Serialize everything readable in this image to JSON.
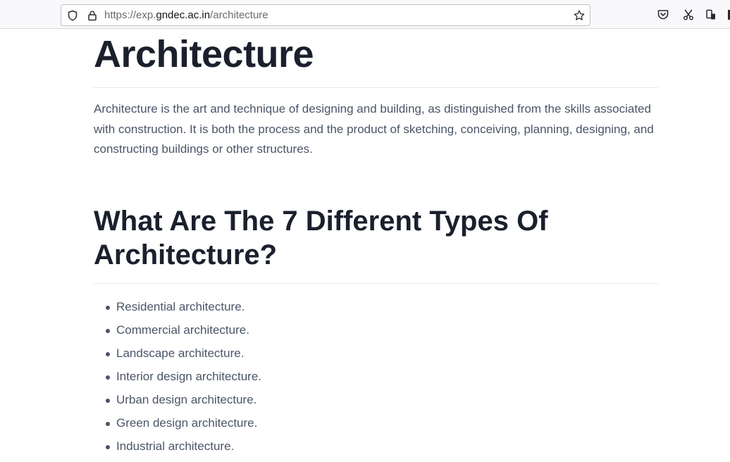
{
  "browser": {
    "url_prefix": "https://exp.",
    "url_domain": "gndec.ac.in",
    "url_path": "/architecture",
    "icons": {
      "tracking": "shield-icon",
      "security": "lock-icon",
      "bookmark": "star-icon",
      "pocket": "pocket-icon",
      "screenshot": "scissors-icon",
      "extension": "extensions-icon"
    }
  },
  "page": {
    "title": "Architecture",
    "intro": "Architecture is the art and technique of designing and building, as distinguished from the skills associated with construction. It is both the process and the product of sketching, conceiving, planning, designing, and constructing buildings or other structures.",
    "section_heading": "What Are The 7 Different Types Of Architecture?",
    "types": [
      "Residential architecture.",
      "Commercial architecture.",
      "Landscape architecture.",
      "Interior design architecture.",
      "Urban design architecture.",
      "Green design architecture.",
      "Industrial architecture."
    ]
  },
  "colors": {
    "heading": "#1a202c",
    "body_text": "#4a5568",
    "rule": "#e2e8f0",
    "toolbar_bg": "#f9f9fb"
  }
}
